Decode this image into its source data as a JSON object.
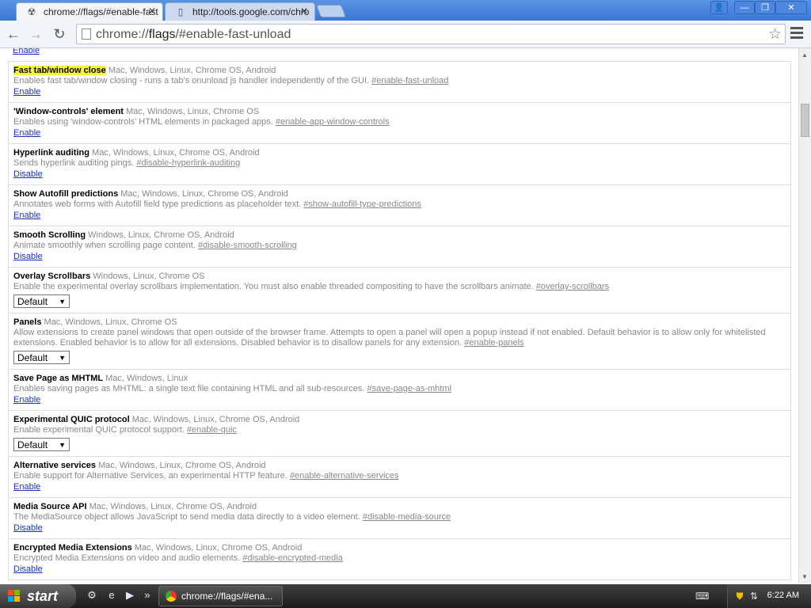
{
  "browser": {
    "tabs": [
      {
        "title": "chrome://flags/#enable-fast",
        "active": true
      },
      {
        "title": "http://tools.google.com/chro",
        "active": false
      }
    ],
    "url_prefix": "chrome://",
    "url_host": "flags",
    "url_rest": "/#enable-fast-unload"
  },
  "flags": {
    "first_action": "Enable",
    "items": [
      {
        "title": "Fast tab/window close",
        "platforms": "Mac, Windows, Linux, Chrome OS, Android",
        "desc": "Enables fast tab/window closing - runs a tab's onunload js handler independently of the GUI.",
        "link": "#enable-fast-unload",
        "action": "Enable"
      },
      {
        "title": "'Window-controls' element",
        "platforms": "Mac, Windows, Linux, Chrome OS",
        "desc": "Enables using 'window-controls' HTML elements in packaged apps.",
        "link": "#enable-app-window-controls",
        "action": "Enable"
      },
      {
        "title": "Hyperlink auditing",
        "platforms": "Mac, Windows, Linux, Chrome OS, Android",
        "desc": "Sends hyperlink auditing pings.",
        "link": "#disable-hyperlink-auditing",
        "action": "Disable"
      },
      {
        "title": "Show Autofill predictions",
        "platforms": "Mac, Windows, Linux, Chrome OS, Android",
        "desc": "Annotates web forms with Autofill field type predictions as placeholder text.",
        "link": "#show-autofill-type-predictions",
        "action": "Enable"
      },
      {
        "title": "Smooth Scrolling",
        "platforms": "Windows, Linux, Chrome OS, Android",
        "desc": "Animate smoothly when scrolling page content.",
        "link": "#disable-smooth-scrolling",
        "action": "Disable"
      },
      {
        "title": "Overlay Scrollbars",
        "platforms": "Windows, Linux, Chrome OS",
        "desc": "Enable the experimental overlay scrollbars implementation. You must also enable threaded compositing to have the scrollbars animate.",
        "link": "#overlay-scrollbars",
        "select": "Default"
      },
      {
        "title": "Panels",
        "platforms": "Mac, Windows, Linux, Chrome OS",
        "desc": "Allow extensions to create panel windows that open outside of the browser frame. Attempts to open a panel will open a popup instead if not enabled. Default behavior is to allow only for whitelisted extensions. Enabled behavior is to allow for all extensions. Disabled behavior is to disallow panels for any extension.",
        "link": "#enable-panels",
        "select": "Default"
      },
      {
        "title": "Save Page as MHTML",
        "platforms": "Mac, Windows, Linux",
        "desc": "Enables saving pages as MHTML: a single text file containing HTML and all sub-resources.",
        "link": "#save-page-as-mhtml",
        "action": "Enable"
      },
      {
        "title": "Experimental QUIC protocol",
        "platforms": "Mac, Windows, Linux, Chrome OS, Android",
        "desc": "Enable experimental QUIC protocol support.",
        "link": "#enable-quic",
        "select": "Default"
      },
      {
        "title": "Alternative services",
        "platforms": "Mac, Windows, Linux, Chrome OS, Android",
        "desc": "Enable support for Alternative Services, an experimental HTTP feature.",
        "link": "#enable-alternative-services",
        "action": "Enable"
      },
      {
        "title": "Media Source API",
        "platforms": "Mac, Windows, Linux, Chrome OS, Android",
        "desc": "The MediaSource object allows JavaScript to send media data directly to a video element.",
        "link": "#disable-media-source",
        "action": "Disable"
      },
      {
        "title": "Encrypted Media Extensions",
        "platforms": "Mac, Windows, Linux, Chrome OS, Android",
        "desc": "Encrypted Media Extensions on video and audio elements.",
        "link": "#disable-encrypted-media",
        "action": "Disable"
      }
    ]
  },
  "taskbar": {
    "start_label": "start",
    "window_label": "chrome://flags/#ena...",
    "clock": "6:22 AM"
  }
}
